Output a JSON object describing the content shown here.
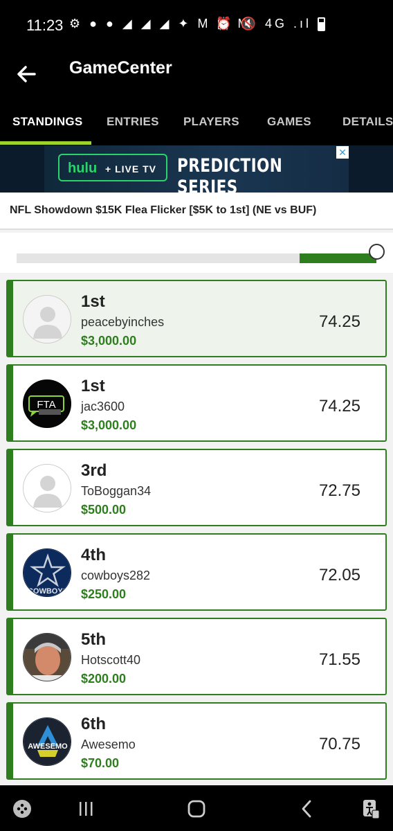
{
  "status_bar": {
    "time": "11:23",
    "left_icons": "⚙ ● ● ◢ ◢ ◢ ✦ M ▣ M",
    "right_icons": "⏰ 🔇 4G .ıl"
  },
  "header": {
    "title": "GameCenter"
  },
  "tabs": [
    {
      "label": "STANDINGS",
      "active": true
    },
    {
      "label": "ENTRIES",
      "active": false
    },
    {
      "label": "PLAYERS",
      "active": false
    },
    {
      "label": "GAMES",
      "active": false
    },
    {
      "label": "DETAILS",
      "active": false
    }
  ],
  "ad": {
    "brand": "hulu",
    "sub": "+ LIVE TV",
    "headline": "PREDICTION SERIES"
  },
  "contest": {
    "title": "NFL Showdown $15K Flea Flicker [$5K to 1st] (NE vs BUF)"
  },
  "slider": {
    "level": 1.0
  },
  "entries": [
    {
      "rank": "1st",
      "username": "peacebyinches",
      "prize": "$3,000.00",
      "score": "74.25",
      "avatar": "default-avatar"
    },
    {
      "rank": "1st",
      "username": "jac3600",
      "prize": "$3,000.00",
      "score": "74.25",
      "avatar": "fta-logo",
      "avatar_text": "FTA"
    },
    {
      "rank": "3rd",
      "username": "ToBoggan34",
      "prize": "$500.00",
      "score": "72.75",
      "avatar": "default-avatar"
    },
    {
      "rank": "4th",
      "username": "cowboys282",
      "prize": "$250.00",
      "score": "72.05",
      "avatar": "cowboys-logo",
      "avatar_text": "COWBOYS"
    },
    {
      "rank": "5th",
      "username": "Hotscott40",
      "prize": "$200.00",
      "score": "71.55",
      "avatar": "user-photo"
    },
    {
      "rank": "6th",
      "username": "Awesemo",
      "prize": "$70.00",
      "score": "70.75",
      "avatar": "awesemo-logo",
      "avatar_text": "AWESEMO"
    }
  ],
  "colors": {
    "accent_green": "#2e7d1e",
    "tab_indicator": "#9bd52a",
    "header_bg": "#000000"
  }
}
